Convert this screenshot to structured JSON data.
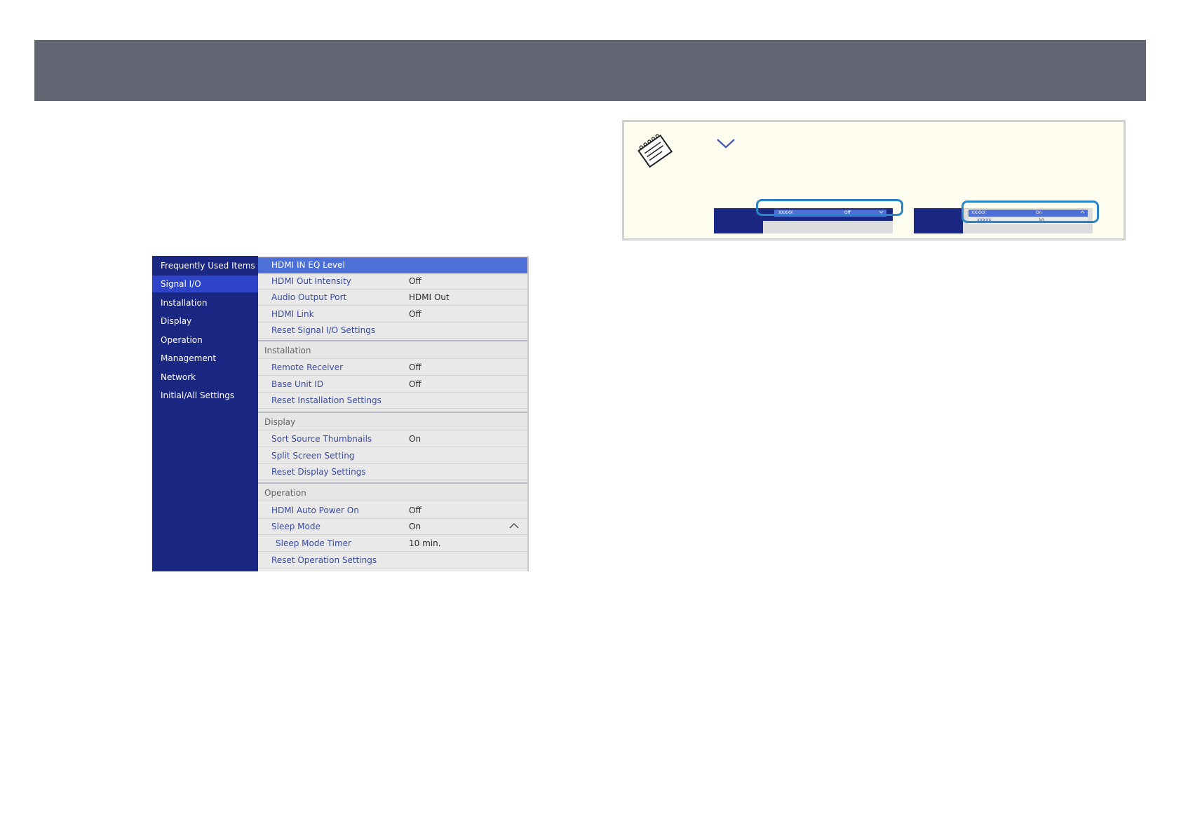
{
  "sidebar": {
    "items": [
      {
        "label": "Frequently Used Items"
      },
      {
        "label": "Signal I/O"
      },
      {
        "label": "Installation"
      },
      {
        "label": "Display"
      },
      {
        "label": "Operation"
      },
      {
        "label": "Management"
      },
      {
        "label": "Network"
      },
      {
        "label": "Initial/All Settings"
      }
    ],
    "active": "Signal I/O"
  },
  "signal_io": {
    "rows": [
      {
        "label": "HDMI IN EQ Level",
        "value": ""
      },
      {
        "label": "HDMI Out Intensity",
        "value": "Off"
      },
      {
        "label": "Audio Output Port",
        "value": "HDMI Out"
      },
      {
        "label": "HDMI Link",
        "value": "Off"
      },
      {
        "label": "Reset Signal I/O Settings",
        "value": ""
      }
    ]
  },
  "installation": {
    "header": "Installation",
    "rows": [
      {
        "label": "Remote Receiver",
        "value": "Off"
      },
      {
        "label": "Base Unit ID",
        "value": "Off"
      },
      {
        "label": "Reset Installation Settings",
        "value": ""
      }
    ]
  },
  "display": {
    "header": "Display",
    "rows": [
      {
        "label": "Sort Source Thumbnails",
        "value": "On"
      },
      {
        "label": "Split Screen Setting",
        "value": ""
      },
      {
        "label": "Reset Display Settings",
        "value": ""
      }
    ]
  },
  "operation": {
    "header": "Operation",
    "rows": [
      {
        "label": "HDMI Auto Power On",
        "value": "Off"
      },
      {
        "label": "Sleep Mode",
        "value": "On"
      },
      {
        "label": "Sleep Mode Timer",
        "value": "10 min."
      },
      {
        "label": "Reset Operation Settings",
        "value": ""
      }
    ]
  },
  "note": {
    "example_before": {
      "item": "XXXXX",
      "value": "Off"
    },
    "example_after": {
      "item": "XXXXX",
      "value": "On",
      "sub_item": "XXXXX",
      "sub_value": "10"
    }
  },
  "colors": {
    "header_band": "#626673",
    "sidebar": "#1b2883",
    "sidebar_active": "#2f45c9",
    "row_highlight": "#4d6fd8",
    "note_bg": "#fffdf0",
    "ring": "#2a86c7"
  },
  "icons": [
    "memo-pad-icon",
    "chevron-down-icon",
    "chevron-up-icon",
    "right-arrow-icon"
  ]
}
